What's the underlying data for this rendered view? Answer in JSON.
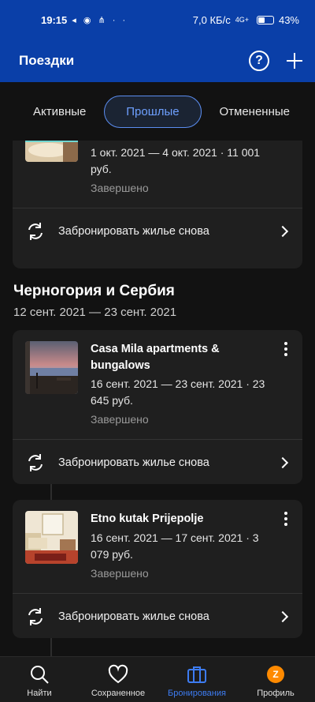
{
  "statusbar": {
    "time": "19:15",
    "left_icons": "◂ ◉ ⋔ · ·",
    "speed": "7,0 КБ/с",
    "network": "4G+",
    "battery": "43%",
    "battery_level": 0.43
  },
  "appbar": {
    "title": "Поездки",
    "help_icon": "?"
  },
  "tabs": [
    {
      "label": "Активные",
      "active": false
    },
    {
      "label": "Прошлые",
      "active": true
    },
    {
      "label": "Отмененные",
      "active": false
    }
  ],
  "first_booking": {
    "dates": "1 окт. 2021 — 4 окт. 2021 · 11 001 руб.",
    "status": "Завершено",
    "rebook_label": "Забронировать жилье снова"
  },
  "trip": {
    "title": "Черногория и Сербия",
    "dates": "12 сент. 2021 — 23 сент. 2021",
    "bookings": [
      {
        "name": "Casa Mila apartments & bungalows",
        "dates": "16 сент. 2021 — 23 сент. 2021 · 23 645 руб.",
        "status": "Завершено",
        "rebook_label": "Забронировать жилье снова"
      },
      {
        "name": "Etno kutak Prijepolje",
        "dates": "16 сент. 2021 — 17 сент. 2021 · 3 079 руб.",
        "status": "Завершено",
        "rebook_label": "Забронировать жилье снова"
      }
    ]
  },
  "bottom_nav": [
    {
      "label": "Найти",
      "icon": "search-icon"
    },
    {
      "label": "Сохраненное",
      "icon": "heart-icon"
    },
    {
      "label": "Бронирования",
      "icon": "briefcase-icon",
      "active": true
    },
    {
      "label": "Профиль",
      "icon": "avatar",
      "avatar_letter": "Z"
    }
  ]
}
